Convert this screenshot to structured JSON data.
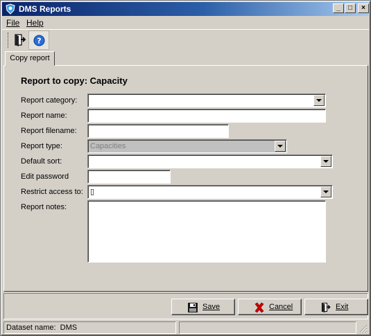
{
  "window": {
    "title": "DMS Reports",
    "controls": {
      "minimize": "_",
      "maximize": "□",
      "close": "×"
    }
  },
  "menu": {
    "file": "File",
    "help": "Help"
  },
  "toolbar": {
    "exit_icon": "exit-door-icon",
    "help_icon": "help-question-icon"
  },
  "tabs": [
    {
      "label": "Copy report",
      "active": true
    }
  ],
  "form": {
    "heading": "Report to copy: Capacity",
    "fields": {
      "report_category": {
        "label": "Report category:",
        "value": ""
      },
      "report_name": {
        "label": "Report name:",
        "value": ""
      },
      "report_filename": {
        "label": "Report filename:",
        "value": ""
      },
      "report_type": {
        "label": "Report type:",
        "value": "Capacities",
        "disabled": true
      },
      "default_sort": {
        "label": "Default sort:",
        "value": ""
      },
      "edit_password": {
        "label": "Edit password",
        "value": ""
      },
      "restrict_access": {
        "label": "Restrict access to:",
        "value": "▯"
      },
      "report_notes": {
        "label": "Report notes:",
        "value": ""
      }
    }
  },
  "buttons": {
    "save": {
      "label": "Save",
      "icon": "floppy-disk-icon"
    },
    "cancel": {
      "label": "Cancel",
      "icon": "red-x-icon"
    },
    "exit": {
      "label": "Exit",
      "icon": "exit-door-icon"
    }
  },
  "status": {
    "dataset": "Dataset name:  DMS",
    "right": ""
  },
  "colors": {
    "titlebar_start": "#0a246a",
    "titlebar_end": "#a6caf0",
    "face": "#d4d0c8",
    "cancel_red": "#cc0000"
  }
}
